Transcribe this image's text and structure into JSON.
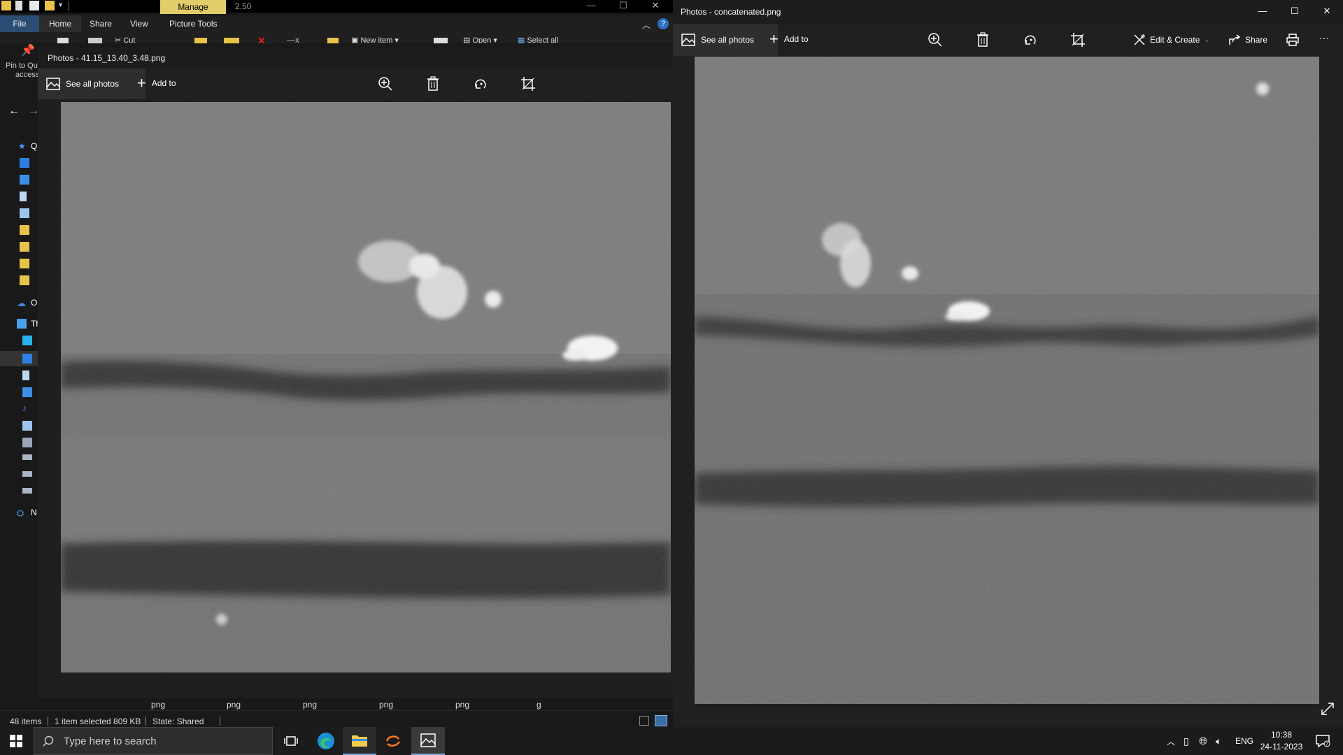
{
  "explorer": {
    "manage_tab": "Manage",
    "title": "2.50",
    "tabs": [
      "File",
      "Home",
      "Share",
      "View",
      "Picture Tools"
    ],
    "commands": {
      "cut": "Cut",
      "new_item": "New item",
      "open": "Open",
      "select_all": "Select all"
    },
    "pin_label_1": "Pin to Qu",
    "pin_label_2": "access",
    "nav_letters": {
      "q": "Q",
      "o": "O",
      "th": "Th",
      "n": "N"
    },
    "status": {
      "items": "48 items",
      "selected": "1 item selected  809 KB",
      "state": "State: Shared"
    },
    "ext_labels": [
      "png",
      "png",
      "png",
      "png",
      "png",
      "g"
    ]
  },
  "photos1": {
    "title": "Photos - 41.15_13.40_3.48.png",
    "see_all": "See all photos",
    "add_to": "Add to"
  },
  "photos2": {
    "title": "Photos - concatenated.png",
    "see_all": "See all photos",
    "add_to": "Add to",
    "edit_create": "Edit & Create",
    "share": "Share",
    "more": "···"
  },
  "taskbar": {
    "search_placeholder": "Type here to search",
    "lang": "ENG",
    "time": "10:38",
    "date": "24-11-2023"
  },
  "colors": {
    "manage_tab": "#e3cc6a",
    "file_tab": "#2b4c73",
    "accent": "#79a7d8"
  }
}
